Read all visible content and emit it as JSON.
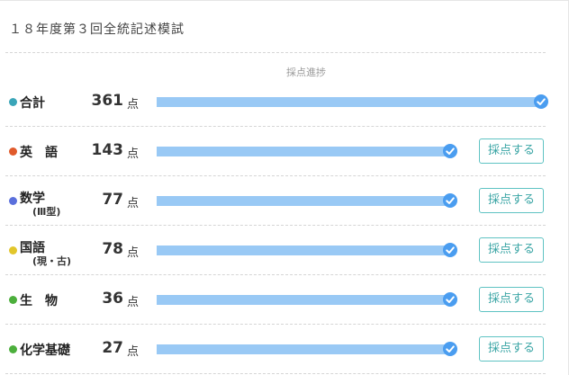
{
  "exam": {
    "title": "１８年度第３回全統記述模試"
  },
  "progress_header": "採点進捗",
  "colors": {
    "bar": "#99c9f5",
    "check": "#4a9df0",
    "button_border": "#5fc3c3"
  },
  "rows": [
    {
      "name": "合計",
      "sub": "",
      "score": "361",
      "unit": "点",
      "dot_color": "#3aa5b8",
      "progress": 1.0,
      "button": ""
    },
    {
      "name": "英　語",
      "sub": "",
      "score": "143",
      "unit": "点",
      "dot_color": "#e05a2b",
      "progress": 1.0,
      "button": "採点する"
    },
    {
      "name": "数学",
      "sub": "(Ⅲ型)",
      "score": "77",
      "unit": "点",
      "dot_color": "#5a6fdc",
      "progress": 1.0,
      "button": "採点する"
    },
    {
      "name": "国語",
      "sub": "(現・古)",
      "score": "78",
      "unit": "点",
      "dot_color": "#e2c62b",
      "progress": 1.0,
      "button": "採点する"
    },
    {
      "name": "生　物",
      "sub": "",
      "score": "36",
      "unit": "点",
      "dot_color": "#4caf3c",
      "progress": 1.0,
      "button": "採点する"
    },
    {
      "name": "化学基礎",
      "sub": "",
      "score": "27",
      "unit": "点",
      "dot_color": "#4caf3c",
      "progress": 1.0,
      "button": "採点する"
    }
  ]
}
